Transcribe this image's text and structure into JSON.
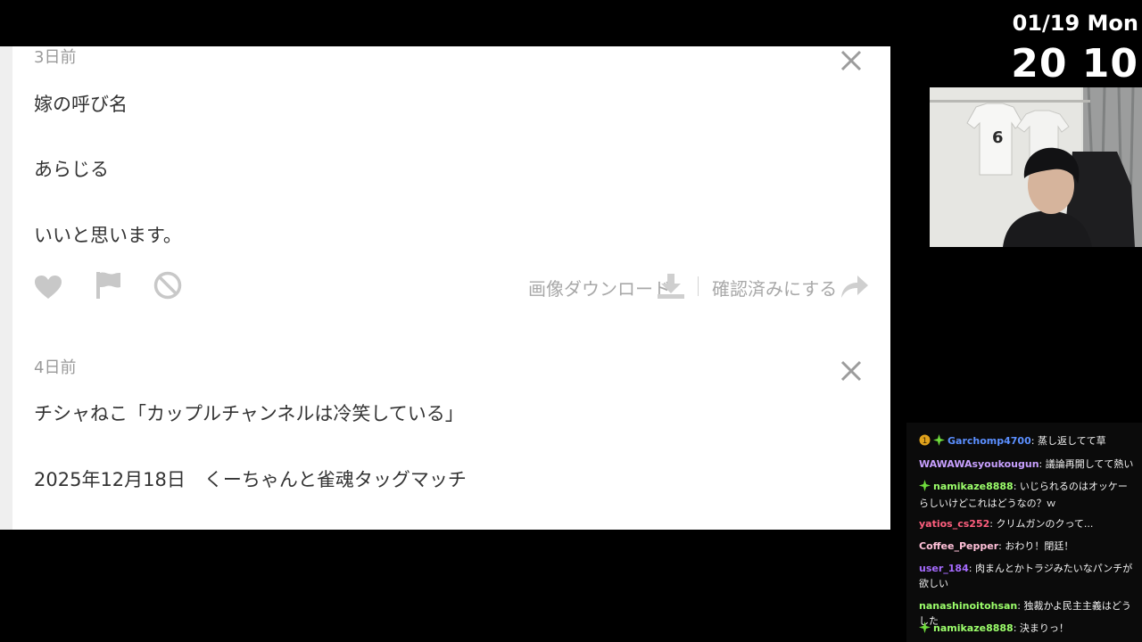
{
  "clock": {
    "date": "01/19 Mon",
    "time": "20 10"
  },
  "posts": [
    {
      "age": "3日前",
      "lines": [
        "嫁の呼び名",
        "あらじる",
        "いいと思います。"
      ],
      "actions": {
        "download": "画像ダウンロード",
        "confirm": "確認済みにする"
      }
    },
    {
      "age": "4日前",
      "lines": [
        "チシャねこ「カップルチャンネルは冷笑している」",
        "2025年12月18日　くーちゃんと雀魂タッグマッチ"
      ]
    }
  ],
  "chat": [
    {
      "user": "Garchomp4700",
      "text": "蒸し返してて草",
      "color": "#5b8fff",
      "badges": [
        "gold-badge-icon",
        "green-sparkle-icon"
      ]
    },
    {
      "user": "WAWAWAsyoukougun",
      "text": "議論再開してて熱い",
      "color": "#c8a0ff",
      "badges": []
    },
    {
      "user": "namikaze8888",
      "text": "いじられるのはオッケーらしいけどこれはどうなの？ｗ",
      "color": "#9cff6b",
      "badges": [
        "green-sparkle-icon"
      ]
    },
    {
      "user": "yatios_cs252",
      "text": "クリムガンのクって...",
      "color": "#ff5f7e",
      "badges": []
    },
    {
      "user": "Coffee_Pepper",
      "text": "おわり！閉廷！",
      "color": "#ffc0d8",
      "badges": []
    },
    {
      "user": "user_184",
      "text": "肉まんとかトラジみたいなパンチが欲しい",
      "color": "#a66bff",
      "badges": []
    },
    {
      "user": "nanashinoitohsan",
      "text": "独裁かよ民主主義はどうした",
      "color": "#9cff6b",
      "badges": []
    },
    {
      "user": "namikaze8888",
      "text": "決まりっ！",
      "color": "#9cff6b",
      "badges": [
        "green-sparkle-icon"
      ]
    }
  ]
}
